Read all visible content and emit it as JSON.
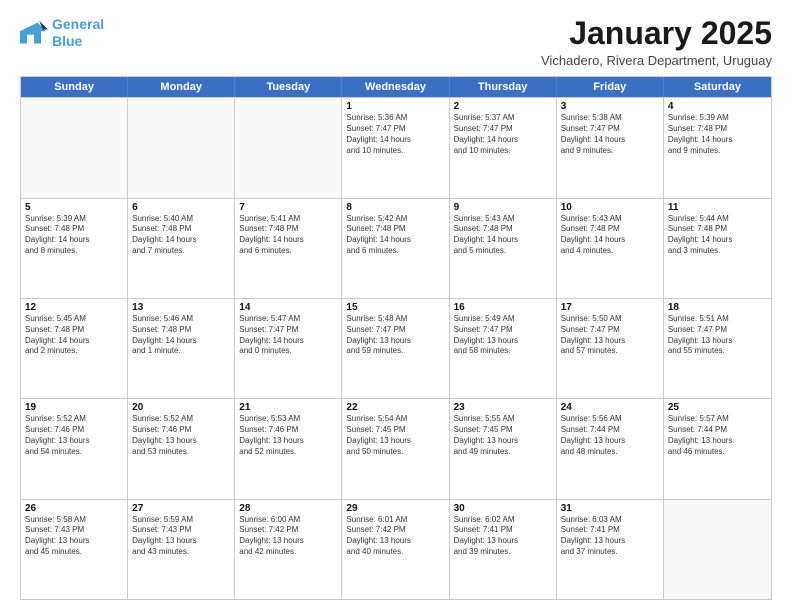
{
  "logo": {
    "line1": "General",
    "line2": "Blue"
  },
  "title": "January 2025",
  "subtitle": "Vichadero, Rivera Department, Uruguay",
  "days": [
    "Sunday",
    "Monday",
    "Tuesday",
    "Wednesday",
    "Thursday",
    "Friday",
    "Saturday"
  ],
  "rows": [
    [
      {
        "day": "",
        "lines": []
      },
      {
        "day": "",
        "lines": []
      },
      {
        "day": "",
        "lines": []
      },
      {
        "day": "1",
        "lines": [
          "Sunrise: 5:36 AM",
          "Sunset: 7:47 PM",
          "Daylight: 14 hours",
          "and 10 minutes."
        ]
      },
      {
        "day": "2",
        "lines": [
          "Sunrise: 5:37 AM",
          "Sunset: 7:47 PM",
          "Daylight: 14 hours",
          "and 10 minutes."
        ]
      },
      {
        "day": "3",
        "lines": [
          "Sunrise: 5:38 AM",
          "Sunset: 7:47 PM",
          "Daylight: 14 hours",
          "and 9 minutes."
        ]
      },
      {
        "day": "4",
        "lines": [
          "Sunrise: 5:39 AM",
          "Sunset: 7:48 PM",
          "Daylight: 14 hours",
          "and 9 minutes."
        ]
      }
    ],
    [
      {
        "day": "5",
        "lines": [
          "Sunrise: 5:39 AM",
          "Sunset: 7:48 PM",
          "Daylight: 14 hours",
          "and 8 minutes."
        ]
      },
      {
        "day": "6",
        "lines": [
          "Sunrise: 5:40 AM",
          "Sunset: 7:48 PM",
          "Daylight: 14 hours",
          "and 7 minutes."
        ]
      },
      {
        "day": "7",
        "lines": [
          "Sunrise: 5:41 AM",
          "Sunset: 7:48 PM",
          "Daylight: 14 hours",
          "and 6 minutes."
        ]
      },
      {
        "day": "8",
        "lines": [
          "Sunrise: 5:42 AM",
          "Sunset: 7:48 PM",
          "Daylight: 14 hours",
          "and 6 minutes."
        ]
      },
      {
        "day": "9",
        "lines": [
          "Sunrise: 5:43 AM",
          "Sunset: 7:48 PM",
          "Daylight: 14 hours",
          "and 5 minutes."
        ]
      },
      {
        "day": "10",
        "lines": [
          "Sunrise: 5:43 AM",
          "Sunset: 7:48 PM",
          "Daylight: 14 hours",
          "and 4 minutes."
        ]
      },
      {
        "day": "11",
        "lines": [
          "Sunrise: 5:44 AM",
          "Sunset: 7:48 PM",
          "Daylight: 14 hours",
          "and 3 minutes."
        ]
      }
    ],
    [
      {
        "day": "12",
        "lines": [
          "Sunrise: 5:45 AM",
          "Sunset: 7:48 PM",
          "Daylight: 14 hours",
          "and 2 minutes."
        ]
      },
      {
        "day": "13",
        "lines": [
          "Sunrise: 5:46 AM",
          "Sunset: 7:48 PM",
          "Daylight: 14 hours",
          "and 1 minute."
        ]
      },
      {
        "day": "14",
        "lines": [
          "Sunrise: 5:47 AM",
          "Sunset: 7:47 PM",
          "Daylight: 14 hours",
          "and 0 minutes."
        ]
      },
      {
        "day": "15",
        "lines": [
          "Sunrise: 5:48 AM",
          "Sunset: 7:47 PM",
          "Daylight: 13 hours",
          "and 59 minutes."
        ]
      },
      {
        "day": "16",
        "lines": [
          "Sunrise: 5:49 AM",
          "Sunset: 7:47 PM",
          "Daylight: 13 hours",
          "and 58 minutes."
        ]
      },
      {
        "day": "17",
        "lines": [
          "Sunrise: 5:50 AM",
          "Sunset: 7:47 PM",
          "Daylight: 13 hours",
          "and 57 minutes."
        ]
      },
      {
        "day": "18",
        "lines": [
          "Sunrise: 5:51 AM",
          "Sunset: 7:47 PM",
          "Daylight: 13 hours",
          "and 55 minutes."
        ]
      }
    ],
    [
      {
        "day": "19",
        "lines": [
          "Sunrise: 5:52 AM",
          "Sunset: 7:46 PM",
          "Daylight: 13 hours",
          "and 54 minutes."
        ]
      },
      {
        "day": "20",
        "lines": [
          "Sunrise: 5:52 AM",
          "Sunset: 7:46 PM",
          "Daylight: 13 hours",
          "and 53 minutes."
        ]
      },
      {
        "day": "21",
        "lines": [
          "Sunrise: 5:53 AM",
          "Sunset: 7:46 PM",
          "Daylight: 13 hours",
          "and 52 minutes."
        ]
      },
      {
        "day": "22",
        "lines": [
          "Sunrise: 5:54 AM",
          "Sunset: 7:45 PM",
          "Daylight: 13 hours",
          "and 50 minutes."
        ]
      },
      {
        "day": "23",
        "lines": [
          "Sunrise: 5:55 AM",
          "Sunset: 7:45 PM",
          "Daylight: 13 hours",
          "and 49 minutes."
        ]
      },
      {
        "day": "24",
        "lines": [
          "Sunrise: 5:56 AM",
          "Sunset: 7:44 PM",
          "Daylight: 13 hours",
          "and 48 minutes."
        ]
      },
      {
        "day": "25",
        "lines": [
          "Sunrise: 5:57 AM",
          "Sunset: 7:44 PM",
          "Daylight: 13 hours",
          "and 46 minutes."
        ]
      }
    ],
    [
      {
        "day": "26",
        "lines": [
          "Sunrise: 5:58 AM",
          "Sunset: 7:43 PM",
          "Daylight: 13 hours",
          "and 45 minutes."
        ]
      },
      {
        "day": "27",
        "lines": [
          "Sunrise: 5:59 AM",
          "Sunset: 7:43 PM",
          "Daylight: 13 hours",
          "and 43 minutes."
        ]
      },
      {
        "day": "28",
        "lines": [
          "Sunrise: 6:00 AM",
          "Sunset: 7:42 PM",
          "Daylight: 13 hours",
          "and 42 minutes."
        ]
      },
      {
        "day": "29",
        "lines": [
          "Sunrise: 6:01 AM",
          "Sunset: 7:42 PM",
          "Daylight: 13 hours",
          "and 40 minutes."
        ]
      },
      {
        "day": "30",
        "lines": [
          "Sunrise: 6:02 AM",
          "Sunset: 7:41 PM",
          "Daylight: 13 hours",
          "and 39 minutes."
        ]
      },
      {
        "day": "31",
        "lines": [
          "Sunrise: 6:03 AM",
          "Sunset: 7:41 PM",
          "Daylight: 13 hours",
          "and 37 minutes."
        ]
      },
      {
        "day": "",
        "lines": []
      }
    ]
  ]
}
